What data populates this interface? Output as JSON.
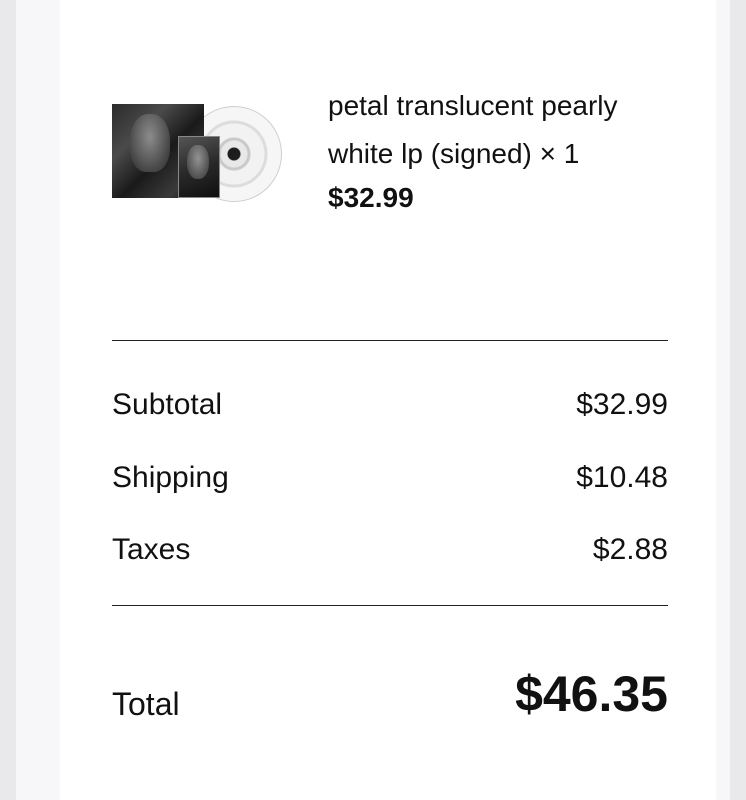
{
  "product": {
    "image_icon": "vinyl-record-cover",
    "name_line1": "petal translucent pearly",
    "name_line2": "white lp (signed) × 1",
    "price": "$32.99"
  },
  "summary": {
    "rows": [
      {
        "label": "Subtotal",
        "value": "$32.99"
      },
      {
        "label": "Shipping",
        "value": "$10.48"
      },
      {
        "label": "Taxes",
        "value": "$2.88"
      }
    ],
    "total_label": "Total",
    "total_value": "$46.35"
  },
  "colors": {
    "background": "#e9e9ec",
    "card": "#ffffff",
    "text": "#111111",
    "divider": "#222222"
  }
}
